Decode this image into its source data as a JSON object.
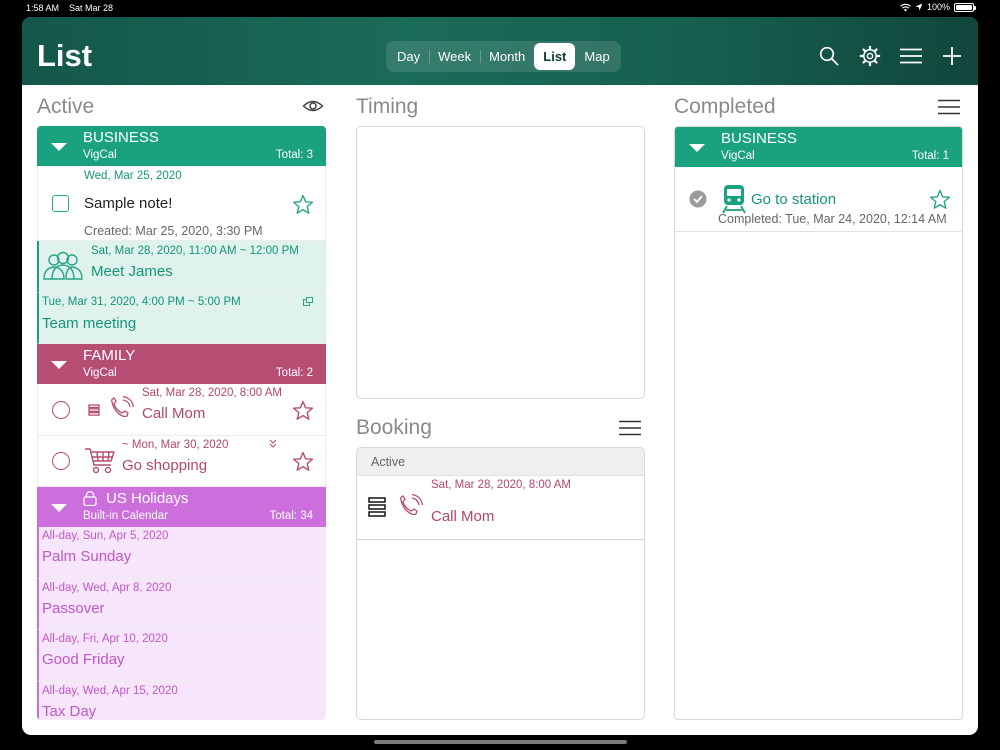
{
  "status": {
    "time": "1:58 AM",
    "date": "Sat Mar 28",
    "battery": "100%"
  },
  "header": {
    "title": "List",
    "views": [
      "Day",
      "Week",
      "Month",
      "List",
      "Map"
    ],
    "selected_view": "List"
  },
  "active": {
    "title": "Active",
    "business": {
      "name": "BUSINESS",
      "source": "VigCal",
      "total": "Total:  3",
      "date_header": "Wed,  Mar  25,  2020",
      "note": {
        "text": "Sample note!",
        "created": "Created: Mar 25, 2020, 3:30 PM"
      },
      "meet": {
        "time": "Sat, Mar 28, 2020, 11:00 AM ~ 12:00 PM",
        "title": "Meet James"
      },
      "team": {
        "time": "Tue, Mar 31, 2020, 4:00 PM ~ 5:00 PM",
        "title": "Team meeting"
      }
    },
    "family": {
      "name": "FAMILY",
      "source": "VigCal",
      "total": "Total:  2",
      "call": {
        "time": "Sat,  Mar  28,  2020,  8:00  AM",
        "title": "Call Mom"
      },
      "shop": {
        "time": "~  Mon,  Mar  30,  2020",
        "title": "Go shopping"
      }
    },
    "holidays": {
      "name": "US  Holidays",
      "source": "Built-in  Calendar",
      "total": "Total:  34",
      "items": [
        {
          "time": "All-day, Sun, Apr 5, 2020",
          "title": "Palm Sunday"
        },
        {
          "time": "All-day, Wed, Apr 8, 2020",
          "title": "Passover"
        },
        {
          "time": "All-day, Fri, Apr 10, 2020",
          "title": "Good Friday"
        },
        {
          "time": "All-day, Wed, Apr 15, 2020",
          "title": "Tax Day"
        }
      ]
    }
  },
  "timing": {
    "title": "Timing"
  },
  "booking": {
    "title": "Booking",
    "section": "Active",
    "item": {
      "time": "Sat,  Mar  28,  2020,  8:00  AM",
      "title": "Call Mom"
    }
  },
  "completed": {
    "title": "Completed",
    "group": {
      "name": "BUSINESS",
      "source": "VigCal",
      "total": "Total:  1"
    },
    "item": {
      "title": "Go to station",
      "completed": "Completed: Tue, Mar 24, 2020, 12:14 AM"
    }
  },
  "colors": {
    "business": "#1aa17f",
    "family": "#b64d73",
    "holidays": "#cc6fdc",
    "header": "#16604f"
  }
}
